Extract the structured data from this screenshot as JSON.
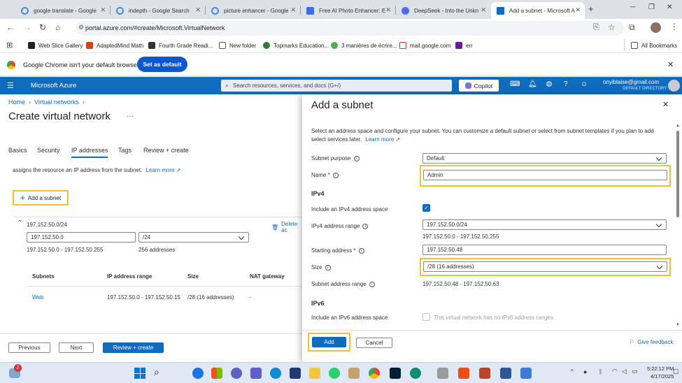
{
  "browser": {
    "tabs": [
      {
        "title": "google translate - Google",
        "color": "#4285f4"
      },
      {
        "title": "indepth - Google Search",
        "color": "#4285f4"
      },
      {
        "title": "picture enhancer - Google",
        "color": "#4285f4"
      },
      {
        "title": "Free AI Photo Enhancer: E",
        "color": "#3d6fe6"
      },
      {
        "title": "DeepSeek - Into the Unkn",
        "color": "#4d6bfe"
      },
      {
        "title": "Add a subnet - Microsoft A",
        "color": "#0f6cbd"
      }
    ],
    "new_tab": "+",
    "url": "portal.azure.com/#create/Microsoft.VirtualNetwork",
    "bookmarks": [
      {
        "label": "Web Slice Gallery",
        "color": "#222"
      },
      {
        "label": "AdaptedMind Math",
        "color": "#d84315"
      },
      {
        "label": "Fourth Grade Readi...",
        "color": "#333"
      },
      {
        "label": "New folder",
        "color": "#555"
      },
      {
        "label": "Topmarks Education...",
        "color": "#2e7d32"
      },
      {
        "label": "3 manières de écrire...",
        "color": "#4caf50"
      },
      {
        "label": "mail.google.com",
        "color": "#d93025"
      },
      {
        "label": "err",
        "color": "#6a1b9a"
      }
    ],
    "all_bookmarks": "All Bookmarks",
    "infobar_text": "Google Chrome isn't your default browser",
    "set_default": "Set as default"
  },
  "azure": {
    "brand": "Microsoft Azure",
    "search_placeholder": "Search resources, services, and docs (G+/)",
    "copilot": "Copilot",
    "user_email": "onyiblaise@gmail.com",
    "directory": "DEFAULT DIRECTORY",
    "accent": "#0f6cbd"
  },
  "page": {
    "breadcrumb": [
      "Home",
      "Virtual networks"
    ],
    "title": "Create virtual network",
    "tabs": [
      "Basics",
      "Security",
      "IP addresses",
      "Tags",
      "Review + create"
    ],
    "active_tab": "IP addresses",
    "desc": "assigns the resource an IP address from the subnet.",
    "learn_more": "Learn more",
    "add_subnet": "Add a subnet",
    "address_space": "197.152.50.0/24",
    "delete": "Delete ac",
    "addr_value": "197.152.50.0",
    "prefix": "/24",
    "range": "197.152.50.0 - 197.152.50.255",
    "count": "256 addresses",
    "table": {
      "headers": [
        "Subnets",
        "IP address range",
        "Size",
        "NAT gateway"
      ],
      "rows": [
        [
          "Web",
          "197.152.50.0 - 197.152.50.15",
          "/28 (16 addresses)",
          "-"
        ]
      ]
    },
    "previous": "Previous",
    "next": "Next",
    "review_create": "Review + create"
  },
  "panel": {
    "title": "Add a subnet",
    "intro": "Select an address space and configure your subnet. You can customize a default subnet or select from subnet templates if you plan to add select services later.",
    "learn_more": "Learn more",
    "purpose_label": "Subnet purpose",
    "purpose_value": "Default",
    "name_label": "Name *",
    "name_value": "Admin",
    "ipv4_heading": "IPv4",
    "include_ipv4": "Include an IPv4 address space",
    "ipv4_checked": true,
    "ipv4_range_label": "IPv4 address range",
    "ipv4_range_value": "197.152.50.0/24",
    "ipv4_range_hint": "197.152.50.0 - 197.152.50.255",
    "start_label": "Starting address *",
    "start_value": "197.152.50.48",
    "size_label": "Size",
    "size_value": "/28 (16 addresses)",
    "subnet_range_label": "Subnet address range",
    "subnet_range_value": "197.152.50.48 - 197.152.50.63",
    "ipv6_heading": "IPv6",
    "include_ipv6": "Include an IPv6 address space",
    "ipv6_note": "This virtual network has no IPv6 address ranges.",
    "add": "Add",
    "cancel": "Cancel",
    "feedback": "Give feedback"
  },
  "taskbar": {
    "time": "5:22:12 PM",
    "date": "4/17/2025",
    "badge": "2"
  }
}
